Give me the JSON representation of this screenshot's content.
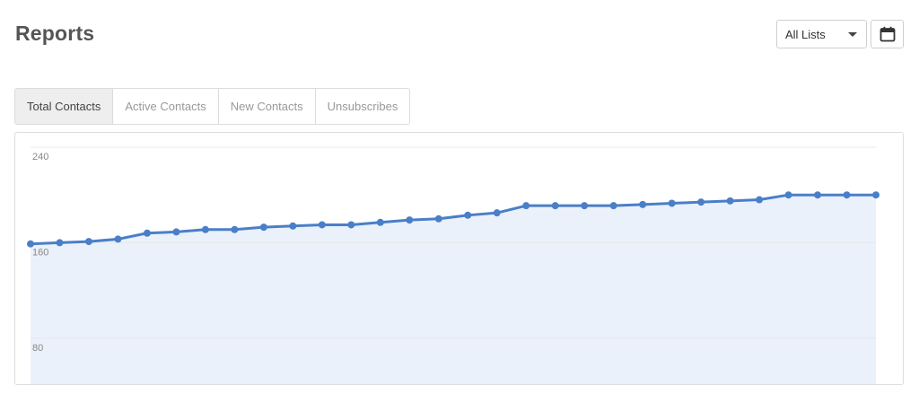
{
  "header": {
    "title": "Reports"
  },
  "filter": {
    "list_select_value": "All Lists"
  },
  "icons": {
    "calendar": "calendar-icon",
    "caret": "caret-down-icon"
  },
  "tabs": [
    {
      "label": "Total Contacts",
      "active": true
    },
    {
      "label": "Active Contacts",
      "active": false
    },
    {
      "label": "New Contacts",
      "active": false
    },
    {
      "label": "Unsubscribes",
      "active": false
    }
  ],
  "colors": {
    "line": "#4a7fc8",
    "area": "#ebf1fa",
    "grid": "#e8e8e8"
  },
  "chart_data": {
    "type": "area",
    "ylim": [
      40,
      240
    ],
    "yticks": [
      {
        "value": 240,
        "label": "240"
      },
      {
        "value": 160,
        "label": "160"
      },
      {
        "value": 80,
        "label": "80"
      }
    ],
    "grid": true,
    "series": [
      {
        "values": [
          159,
          160,
          161,
          163,
          168,
          169,
          171,
          171,
          173,
          174,
          175,
          175,
          177,
          179,
          180,
          183,
          185,
          191,
          191,
          191,
          191,
          192,
          193,
          194,
          195,
          196,
          200,
          200,
          200,
          200
        ]
      }
    ]
  }
}
